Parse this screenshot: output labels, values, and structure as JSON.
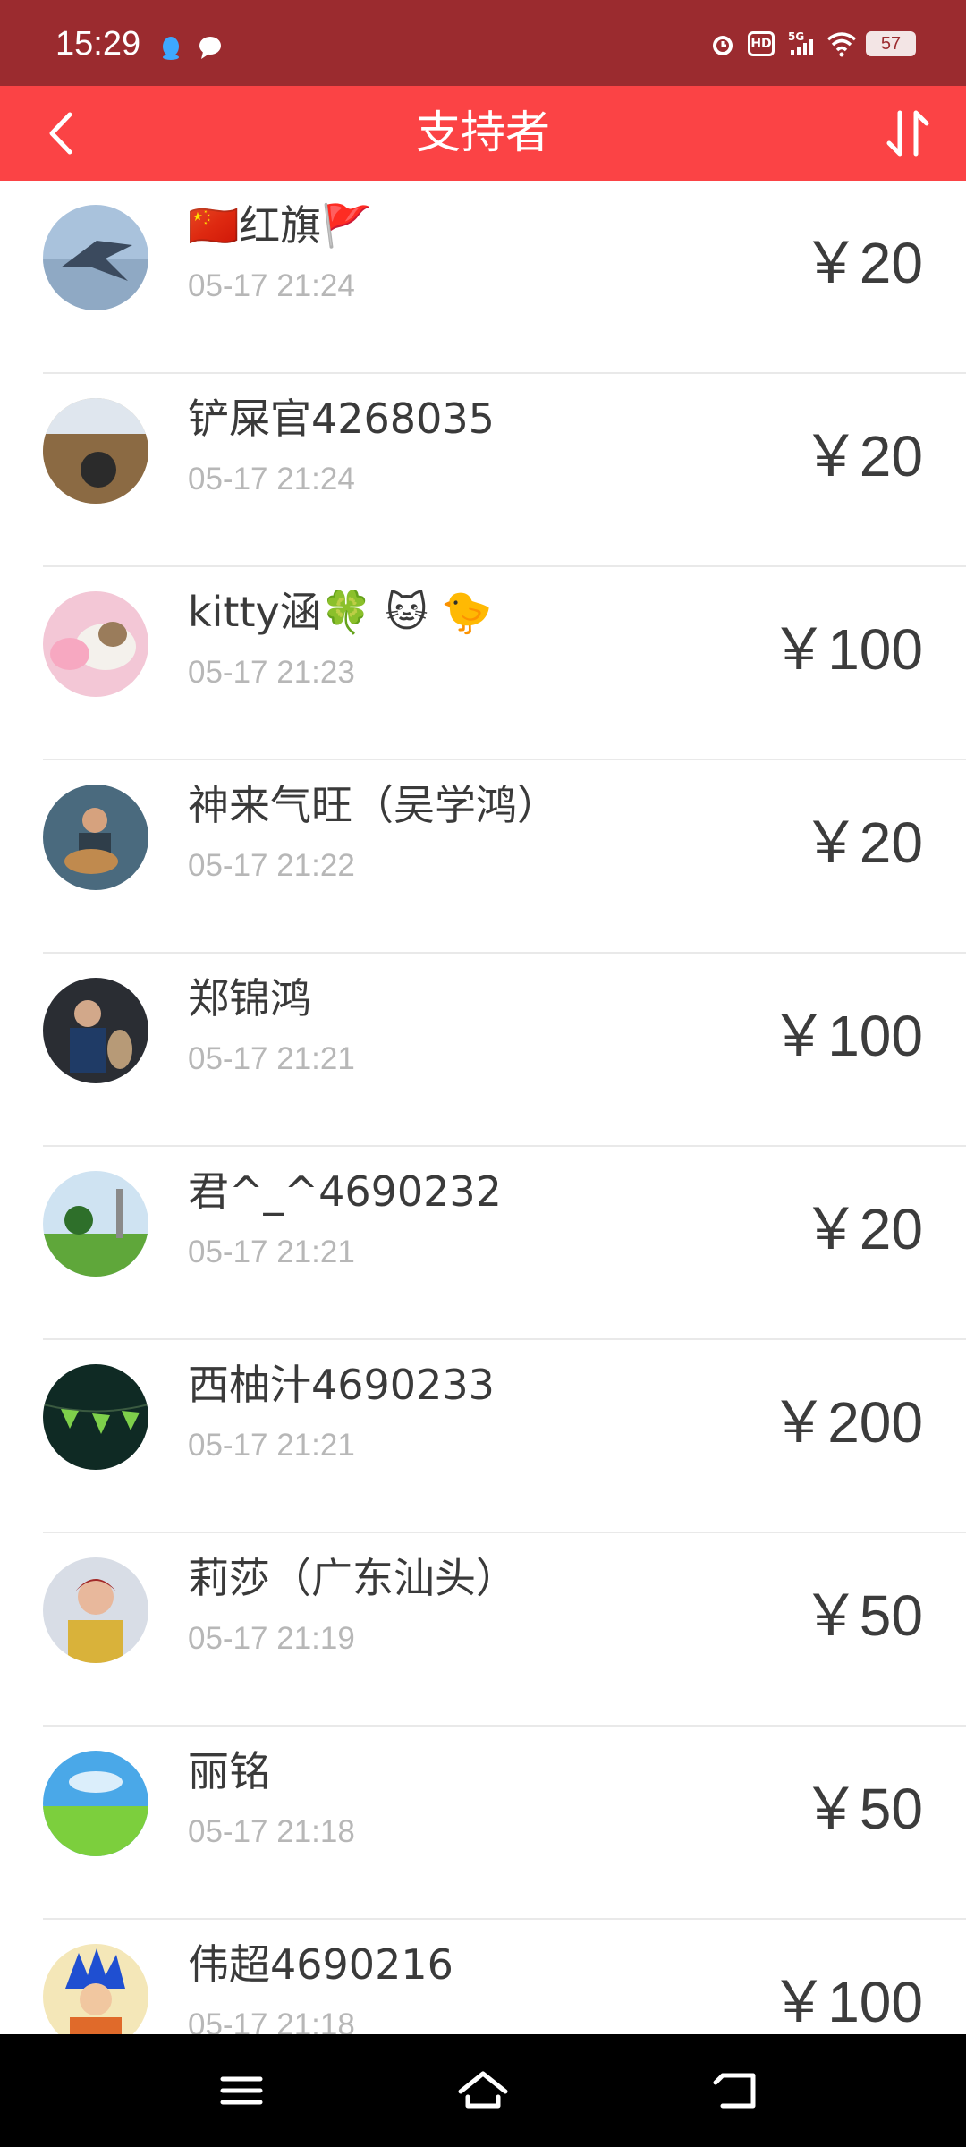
{
  "status_bar": {
    "time": "15:29",
    "network": "5G",
    "hd": "HD",
    "battery": "57"
  },
  "header": {
    "title": "支持者"
  },
  "supporters": [
    {
      "name": "🇨🇳红旗🚩",
      "time": "05-17 21:24",
      "amount": "￥20"
    },
    {
      "name": "铲屎官4268035",
      "time": "05-17 21:24",
      "amount": "￥20"
    },
    {
      "name": "kitty涵🍀 🐱 🐤",
      "time": "05-17 21:23",
      "amount": "￥100"
    },
    {
      "name": "神来气旺（吴学鸿）",
      "time": "05-17 21:22",
      "amount": "￥20"
    },
    {
      "name": "郑锦鸿",
      "time": "05-17 21:21",
      "amount": "￥100"
    },
    {
      "name": "君^_^4690232",
      "time": "05-17 21:21",
      "amount": "￥20"
    },
    {
      "name": "西柚汁4690233",
      "time": "05-17 21:21",
      "amount": "￥200"
    },
    {
      "name": "莉莎（广东汕头）",
      "time": "05-17 21:19",
      "amount": "￥50"
    },
    {
      "name": "丽铭",
      "time": "05-17 21:18",
      "amount": "￥50"
    },
    {
      "name": "伟超4690216",
      "time": "05-17 21:18",
      "amount": "￥100"
    }
  ],
  "icons": {
    "back": "chevron-left-icon",
    "sort": "sort-icon",
    "nav_menu": "menu-icon",
    "nav_home": "home-icon",
    "nav_back": "back-icon"
  },
  "colors": {
    "header": "#fb4345",
    "status_bar": "#9b2b2f"
  }
}
